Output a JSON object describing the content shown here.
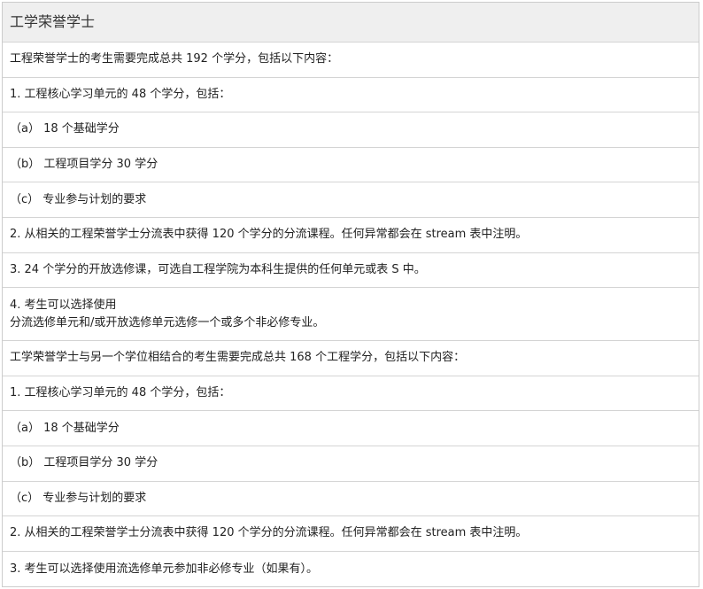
{
  "table": {
    "header": "工学荣誉学士",
    "rows": [
      {
        "text": "工程荣誉学士的考生需要完成总共 192 个学分，包括以下内容："
      },
      {
        "text": "1. 工程核心学习单元的 48 个学分，包括："
      },
      {
        "text": "（a） 18 个基础学分"
      },
      {
        "text": "（b） 工程项目学分 30 学分"
      },
      {
        "text": "（c） 专业参与计划的要求"
      },
      {
        "text": "2. 从相关的工程荣誉学士分流表中获得 120 个学分的分流课程。任何异常都会在 stream 表中注明。"
      },
      {
        "text": "3. 24 个学分的开放选修课，可选自工程学院为本科生提供的任何单元或表 S 中。"
      },
      {
        "line1": "4. 考生可以选择使用",
        "line2": "分流选修单元和/或开放选修单元选修一个或多个非必修专业。"
      },
      {
        "text": "工学荣誉学士与另一个学位相结合的考生需要完成总共 168 个工程学分，包括以下内容："
      },
      {
        "text": "1. 工程核心学习单元的 48 个学分，包括："
      },
      {
        "text": "（a） 18 个基础学分"
      },
      {
        "text": "（b） 工程项目学分 30 学分"
      },
      {
        "text": "（c） 专业参与计划的要求"
      },
      {
        "text": "2. 从相关的工程荣誉学士分流表中获得 120 个学分的分流课程。任何异常都会在 stream 表中注明。"
      },
      {
        "text": "3. 考生可以选择使用流选修单元参加非必修专业（如果有）。"
      }
    ]
  }
}
